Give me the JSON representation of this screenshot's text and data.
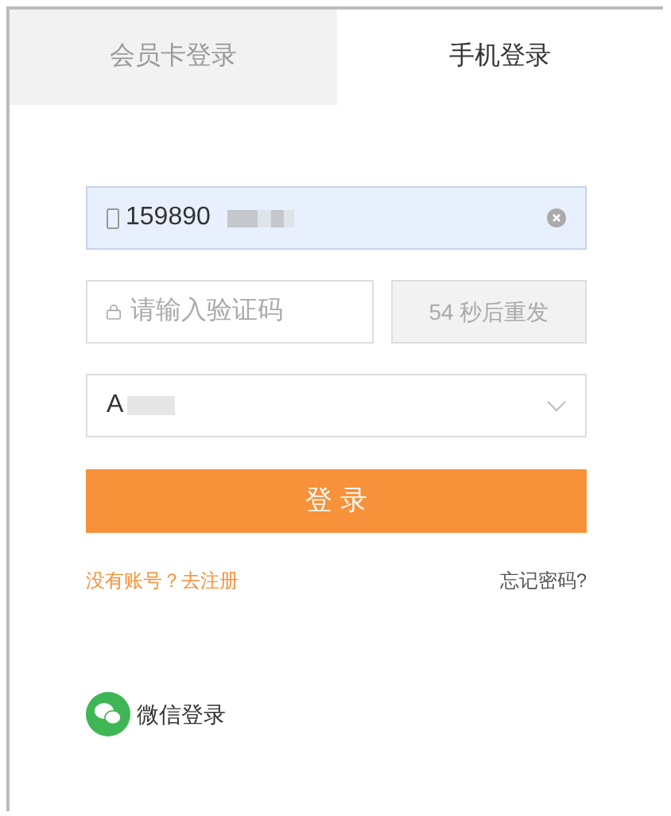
{
  "tabs": [
    {
      "label": "会员卡登录",
      "selected": false
    },
    {
      "label": "手机登录",
      "selected": true
    }
  ],
  "phone": {
    "value": "159890"
  },
  "code": {
    "placeholder": "请输入验证码"
  },
  "resend": {
    "label": "54 秒后重发",
    "disabled": true
  },
  "account_select": {
    "value": "A"
  },
  "login_button": "登 录",
  "register_link": "没有账号？去注册",
  "forgot_link": "忘记密码?",
  "wechat_login": "微信登录"
}
